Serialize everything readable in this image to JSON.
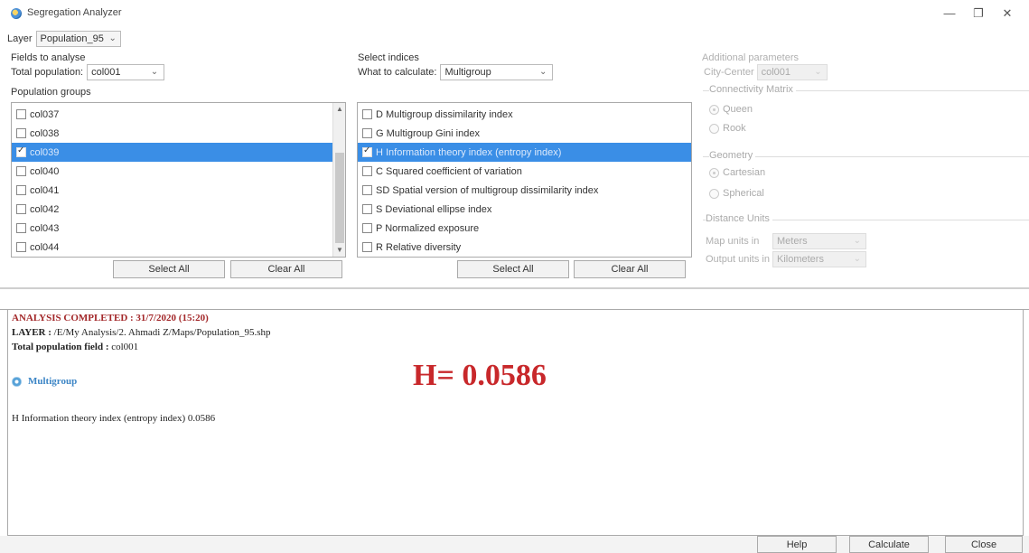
{
  "window": {
    "title": "Segregation Analyzer",
    "minimize": "—",
    "maximize": "❐",
    "close": "✕"
  },
  "layer": {
    "label": "Layer",
    "value": "Population_95"
  },
  "fields": {
    "section_title": "Fields to analyse",
    "total_population_label": "Total population:",
    "total_population_value": "col001",
    "groups_title": "Population groups",
    "items": [
      {
        "label": "col037",
        "checked": false,
        "selected": false
      },
      {
        "label": "col038",
        "checked": false,
        "selected": false
      },
      {
        "label": "col039",
        "checked": true,
        "selected": true
      },
      {
        "label": "col040",
        "checked": false,
        "selected": false
      },
      {
        "label": "col041",
        "checked": false,
        "selected": false
      },
      {
        "label": "col042",
        "checked": false,
        "selected": false
      },
      {
        "label": "col043",
        "checked": false,
        "selected": false
      },
      {
        "label": "col044",
        "checked": false,
        "selected": false
      }
    ],
    "select_all": "Select All",
    "clear_all": "Clear All"
  },
  "indices": {
    "section_title": "Select indices",
    "what_label": "What to calculate:",
    "what_value": "Multigroup",
    "items": [
      {
        "label": "D Multigroup dissimilarity index",
        "checked": false,
        "selected": false
      },
      {
        "label": "G Multigroup Gini index",
        "checked": false,
        "selected": false
      },
      {
        "label": "H Information theory index (entropy index)",
        "checked": true,
        "selected": true
      },
      {
        "label": "C Squared coefficient of variation",
        "checked": false,
        "selected": false
      },
      {
        "label": "SD Spatial version of multigroup dissimilarity index",
        "checked": false,
        "selected": false
      },
      {
        "label": "S Deviational ellipse index",
        "checked": false,
        "selected": false
      },
      {
        "label": "P Normalized exposure",
        "checked": false,
        "selected": false
      },
      {
        "label": "R Relative diversity",
        "checked": false,
        "selected": false
      }
    ],
    "select_all": "Select All",
    "clear_all": "Clear All"
  },
  "params": {
    "section_title": "Additional parameters",
    "city_center_label": "City-Center",
    "city_center_value": "col001",
    "connectivity_title": "Connectivity Matrix",
    "queen": "Queen",
    "rook": "Rook",
    "geometry_title": "Geometry",
    "cartesian": "Cartesian",
    "spherical": "Spherical",
    "units_title": "Distance Units",
    "map_units_label": "Map units in",
    "map_units_value": "Meters",
    "output_units_label": "Output units in",
    "output_units_value": "Kilometers"
  },
  "results": {
    "status": "ANALYSIS COMPLETED : 31/7/2020 (15:20)",
    "layer_label": "LAYER :",
    "layer_path": "/E/My Analysis/2. Ahmadi Z/Maps/Population_95.shp",
    "field_label": "Total population field :",
    "field_value": "col001",
    "group_name": "Multigroup",
    "result_line": "H Information theory index (entropy index)  0.0586",
    "big_value": "H= 0.0586"
  },
  "footer": {
    "help": "Help",
    "calculate": "Calculate",
    "close": "Close"
  },
  "colors": {
    "selection": "#3a8ee6",
    "result_red": "#c8282b",
    "status_red": "#a3282a",
    "link_blue": "#3d86c6"
  }
}
